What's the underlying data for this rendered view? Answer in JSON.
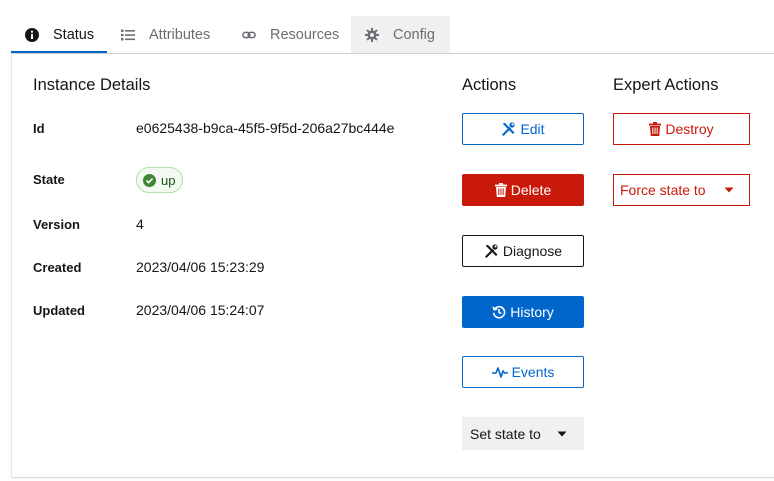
{
  "tabs": [
    {
      "label": "Status",
      "icon": "info-circle-icon",
      "active": true
    },
    {
      "label": "Attributes",
      "icon": "list-icon",
      "active": false
    },
    {
      "label": "Resources",
      "icon": "link-icon",
      "active": false
    },
    {
      "label": "Config",
      "icon": "gear-icon",
      "active": false
    }
  ],
  "details": {
    "title": "Instance Details",
    "id_label": "Id",
    "id_value": "e0625438-b9ca-45f5-9f5d-206a27bc444e",
    "state_label": "State",
    "state_value": "up",
    "version_label": "Version",
    "version_value": "4",
    "created_label": "Created",
    "created_value": "2023/04/06 15:23:29",
    "updated_label": "Updated",
    "updated_value": "2023/04/06 15:24:07"
  },
  "actions": {
    "title": "Actions",
    "edit": "Edit",
    "delete": "Delete",
    "diagnose": "Diagnose",
    "history": "History",
    "events": "Events",
    "set_state": "Set state to"
  },
  "expert": {
    "title": "Expert Actions",
    "destroy": "Destroy",
    "force_state": "Force state to"
  },
  "colors": {
    "primary": "#0066cc",
    "danger": "#c9190b",
    "success": "#3e8635"
  }
}
